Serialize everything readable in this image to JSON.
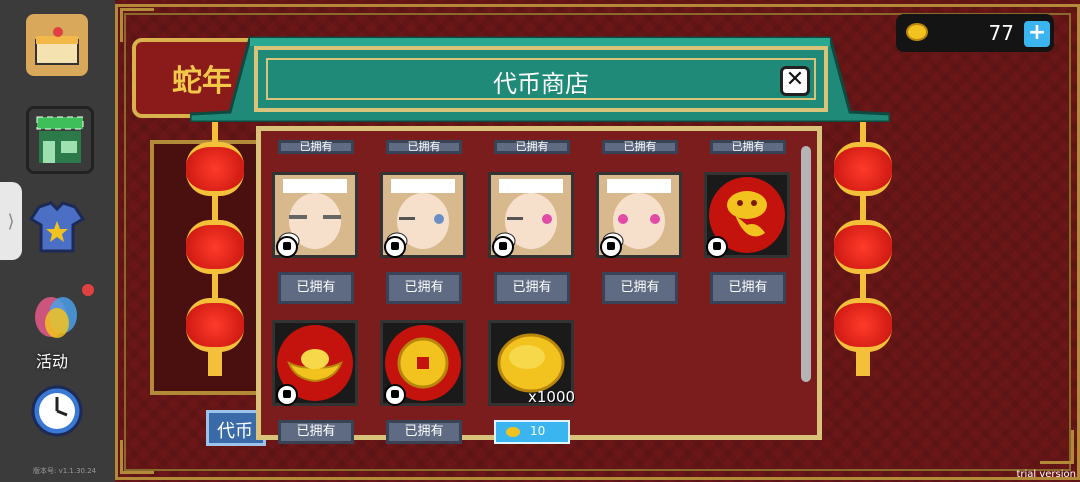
{
  "background": {
    "banner_text": "蛇年",
    "bottom_button_label": "代币"
  },
  "sidebar": {
    "activity_label": "活动",
    "version_text": "版本号: v1.1.30.24",
    "expand_handle": "⟩"
  },
  "currency": {
    "coin_count": "77",
    "add_label": "+"
  },
  "shop": {
    "title": "代币商店",
    "close_label": "✕",
    "top_row_partial_labels": [
      "已拥有",
      "已拥有",
      "已拥有",
      "已拥有",
      "已拥有"
    ],
    "items_row1": [
      {
        "name": "maid-girl-crying",
        "status": "已拥有"
      },
      {
        "name": "maid-girl-winking",
        "status": "已拥有"
      },
      {
        "name": "maid-girl-smirk",
        "status": "已拥有"
      },
      {
        "name": "maid-girl-pink-eyes",
        "status": "已拥有"
      },
      {
        "name": "golden-snake",
        "status": "已拥有"
      }
    ],
    "items_row2": [
      {
        "name": "gold-ingot",
        "status": "已拥有"
      },
      {
        "name": "gold-coin-red",
        "status": "已拥有"
      },
      {
        "name": "gold-coin-pile",
        "quantity": "x1000",
        "price": "10"
      }
    ]
  },
  "watermark": "trial version",
  "colors": {
    "header_teal": "#1f8a78",
    "frame_gold": "#d9c37a",
    "body_red": "#7c1d1d",
    "owned_button": "#5f6b82",
    "buy_button": "#3ab5f0"
  }
}
